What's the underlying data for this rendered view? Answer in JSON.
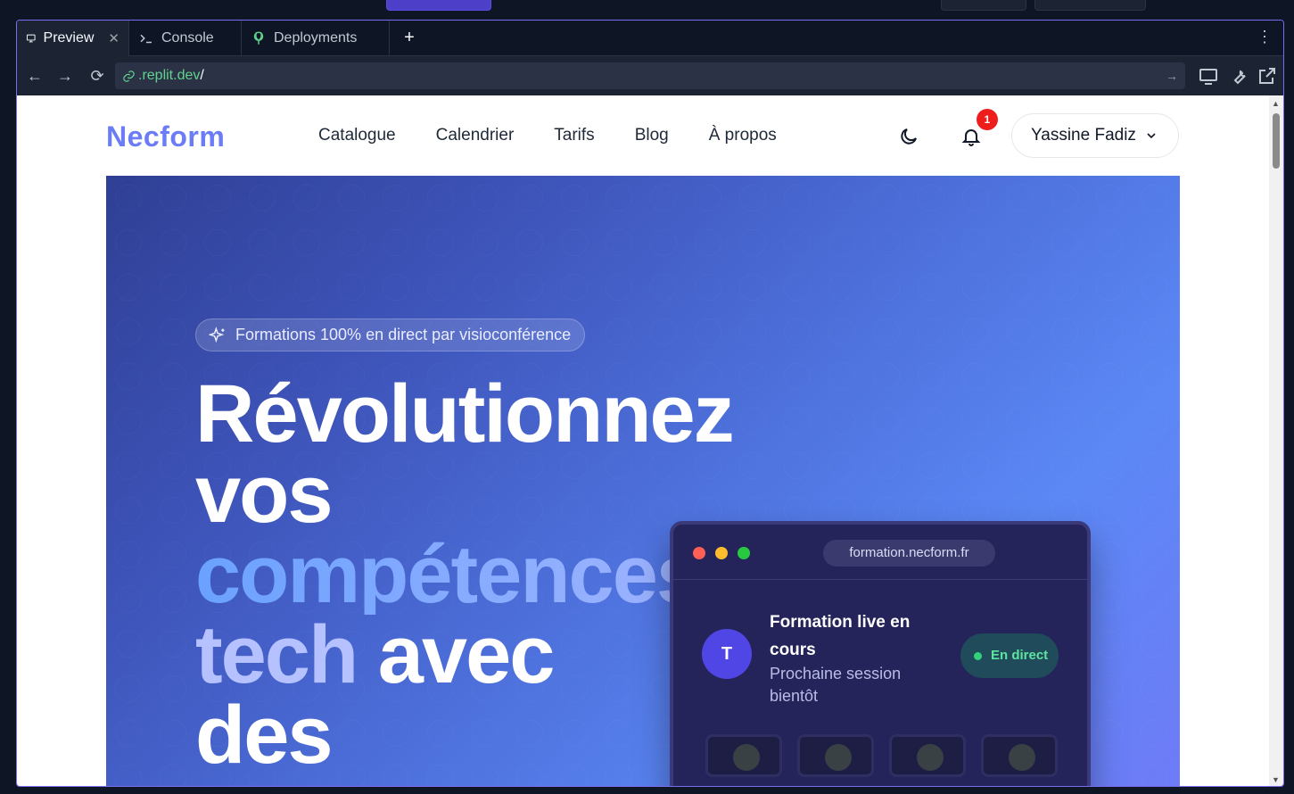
{
  "ide": {
    "tabs": [
      {
        "label": "Preview",
        "icon": "monitor-icon",
        "active": true
      },
      {
        "label": "Console",
        "icon": "terminal-icon",
        "active": false
      },
      {
        "label": "Deployments",
        "icon": "deploy-icon",
        "active": false
      }
    ],
    "url": {
      "host": ".replit.dev",
      "path": "/"
    },
    "accent": "#7c6cf2"
  },
  "site": {
    "logo": "Necform",
    "menu": [
      "Catalogue",
      "Calendrier",
      "Tarifs",
      "Blog",
      "À propos"
    ],
    "notification_count": "1",
    "user_name": "Yassine Fadiz"
  },
  "hero": {
    "chip": "Formations 100% en direct par visioconférence",
    "headline": {
      "line1": "Révolutionnez",
      "line2": "vos",
      "line3": "compétences",
      "line4a": "tech",
      "line4b": " avec",
      "line5": "des"
    },
    "mock": {
      "url": "formation.necform.fr",
      "avatar_letter": "T",
      "title": "Formation live en cours",
      "subtitle": "Prochaine session bientôt",
      "live_label": "En direct",
      "dot_colors": [
        "#ff5f57",
        "#febc2e",
        "#28c840"
      ]
    }
  }
}
